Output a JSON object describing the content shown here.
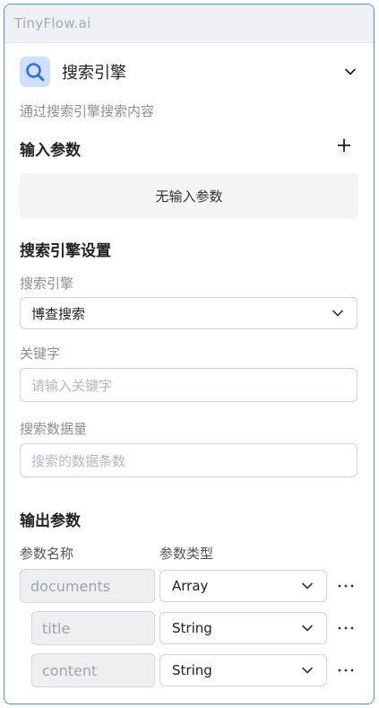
{
  "app": {
    "brand": "TinyFlow.ai"
  },
  "node": {
    "icon": "search-icon",
    "title": "搜索引擎",
    "description": "通过搜索引擎搜索内容"
  },
  "input_params": {
    "title": "输入参数",
    "empty_text": "无输入参数"
  },
  "settings": {
    "title": "搜索引擎设置",
    "engine": {
      "label": "搜索引擎",
      "value": "博查搜索"
    },
    "keyword": {
      "label": "关键字",
      "placeholder": "请输入关键字"
    },
    "count": {
      "label": "搜索数据量",
      "placeholder": "搜索的数据条数"
    }
  },
  "output_params": {
    "title": "输出参数",
    "col_name": "参数名称",
    "col_type": "参数类型",
    "rows": [
      {
        "name": "documents",
        "type": "Array"
      },
      {
        "name": "title",
        "type": "String"
      },
      {
        "name": "content",
        "type": "String"
      }
    ]
  },
  "colors": {
    "accent": "#4a8ef0",
    "icon_bg": "#cfe0ff",
    "icon_fg": "#2f6fe6"
  }
}
